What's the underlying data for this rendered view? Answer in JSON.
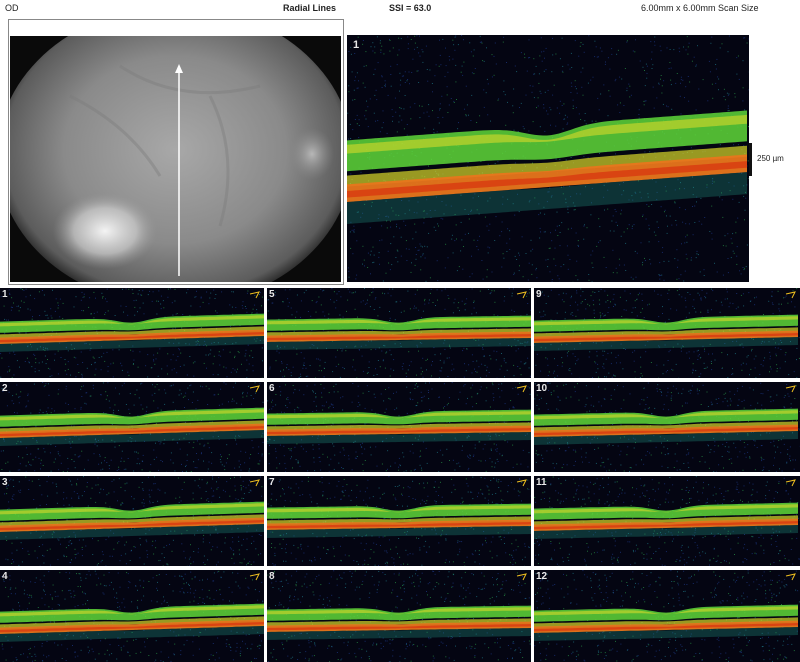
{
  "header": {
    "eye": "OD",
    "protocol": "Radial Lines",
    "ssi": "SSI = 63.0",
    "scan_size": "6.00mm x 6.00mm Scan Size"
  },
  "main_scan": {
    "number": "1",
    "scale_label": "250 µm"
  },
  "thumbnails": [
    {
      "number": "1"
    },
    {
      "number": "2"
    },
    {
      "number": "3"
    },
    {
      "number": "4"
    },
    {
      "number": "5"
    },
    {
      "number": "6"
    },
    {
      "number": "7"
    },
    {
      "number": "8"
    },
    {
      "number": "9"
    },
    {
      "number": "10"
    },
    {
      "number": "11"
    },
    {
      "number": "12"
    }
  ],
  "colors": {
    "retina_green": "#5fd83a",
    "rpe_orange": "#e8761c",
    "rpe_red": "#d83a10",
    "background": "#040512",
    "yellow_layer": "#d8d82a"
  },
  "icons": [
    "scan-direction-arrow-icon"
  ]
}
